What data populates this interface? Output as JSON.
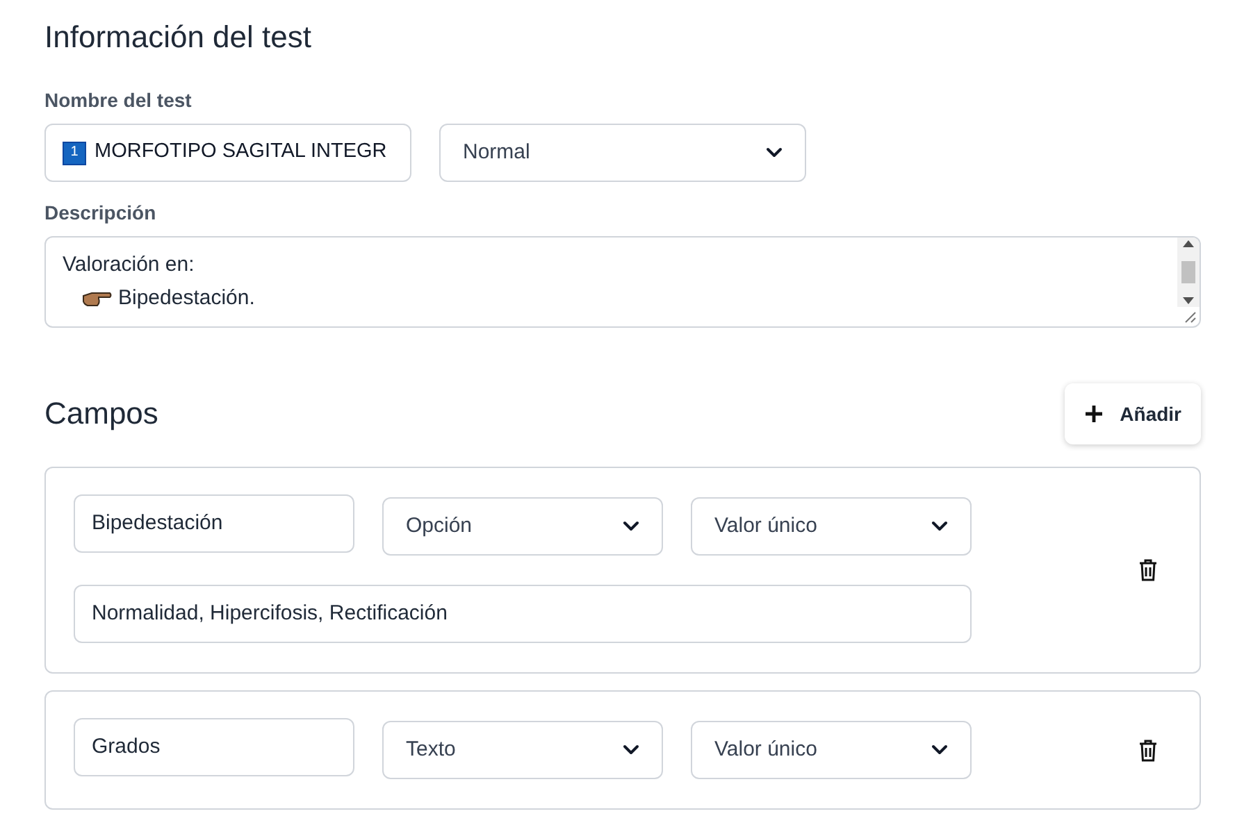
{
  "section_title": "Información del test",
  "name_label": "Nombre del test",
  "name_field": {
    "badge": "1",
    "value": "MORFOTIPO SAGITAL INTEGR"
  },
  "level_select": {
    "value": "Normal"
  },
  "description_label": "Descripción",
  "description_lines": [
    {
      "kind": "plain",
      "text": "Valoración en:"
    },
    {
      "kind": "bullet",
      "text": "Bipedestación."
    }
  ],
  "fields_title": "Campos",
  "add_button": {
    "label": "Añadir"
  },
  "fields": [
    {
      "name": "Bipedestación",
      "type": "Opción",
      "cardinality": "Valor único",
      "options": "Normalidad, Hipercifosis, Rectificación"
    },
    {
      "name": "Grados",
      "type": "Texto",
      "cardinality": "Valor único"
    }
  ]
}
